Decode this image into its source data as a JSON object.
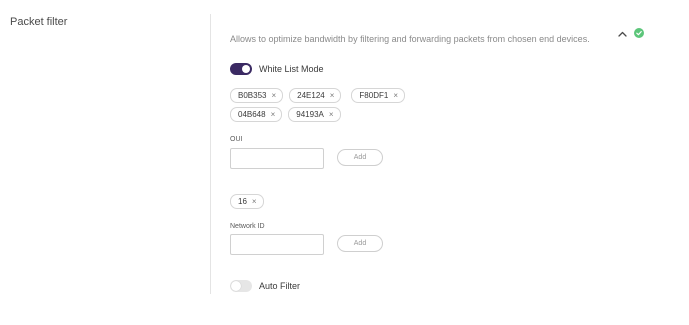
{
  "section": {
    "title": "Packet filter",
    "description": "Allows to optimize bandwidth by filtering and forwarding packets from chosen end devices."
  },
  "status": {
    "icon": "check-circle-icon",
    "color": "#5cc67a"
  },
  "collapse": {
    "icon": "chevron-up-icon"
  },
  "colors": {
    "accent": "#3b2a63",
    "chip_border": "#d6d6d6"
  },
  "white_list": {
    "label": "White List Mode",
    "enabled": true
  },
  "oui_chips": [
    {
      "text": "B0B353",
      "remove": "×"
    },
    {
      "text": "24E124",
      "remove": "×"
    },
    {
      "text": "F80DF1",
      "remove": "×"
    },
    {
      "text": "04B648",
      "remove": "×"
    },
    {
      "text": "94193A",
      "remove": "×"
    }
  ],
  "oui": {
    "label": "OUI",
    "value": "",
    "placeholder": "",
    "add_label": "Add"
  },
  "network_chips": [
    {
      "text": "16",
      "remove": "×"
    }
  ],
  "network_id": {
    "label": "Network ID",
    "value": "",
    "placeholder": "",
    "add_label": "Add"
  },
  "auto_filter": {
    "label": "Auto Filter",
    "enabled": false
  }
}
